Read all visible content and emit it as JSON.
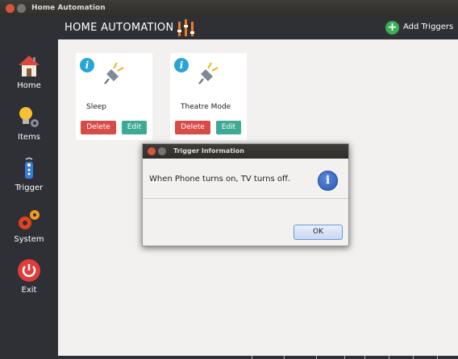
{
  "window": {
    "title": "Home Automation"
  },
  "header": {
    "app_title": "HOME AUTOMATION",
    "add_triggers_label": "Add Triggers"
  },
  "sidebar": {
    "items": [
      {
        "label": "Home",
        "icon": "house-icon"
      },
      {
        "label": "Items",
        "icon": "lightbulb-gear-icon"
      },
      {
        "label": "Trigger",
        "icon": "remote-icon"
      },
      {
        "label": "System",
        "icon": "gears-icon"
      },
      {
        "label": "Exit",
        "icon": "power-icon"
      }
    ]
  },
  "cards": [
    {
      "name": "Sleep",
      "delete_label": "Delete",
      "edit_label": "Edit",
      "info_glyph": "i"
    },
    {
      "name": "Theatre Mode",
      "delete_label": "Delete",
      "edit_label": "Edit",
      "info_glyph": "i"
    }
  ],
  "dialog": {
    "title": "Trigger Information",
    "message": "When Phone turns on, TV turns off.",
    "ok_label": "OK",
    "info_glyph": "i"
  },
  "colors": {
    "sidebar_bg": "#2e3036",
    "delete_btn": "#d84b47",
    "edit_btn": "#3eaa93",
    "info_badge": "#29a4d6",
    "add_button": "#3cae5a",
    "accent_orange": "#f07d22"
  }
}
